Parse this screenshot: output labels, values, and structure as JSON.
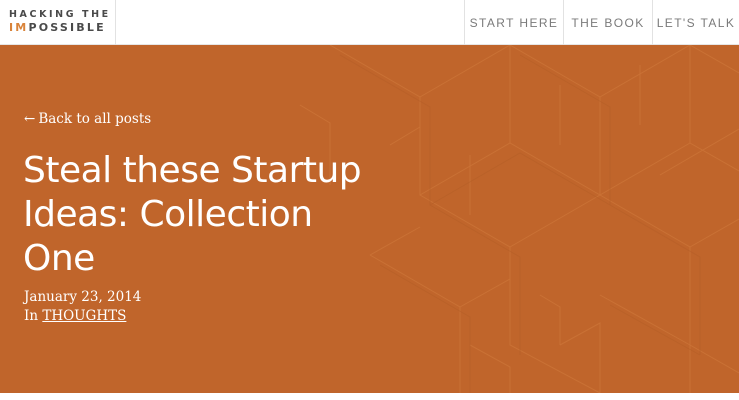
{
  "header": {
    "logo": {
      "line1": "HACKING THE",
      "line2_accent": "IM",
      "line2_rest": "POSSIBLE"
    },
    "nav": [
      {
        "label": "START HERE"
      },
      {
        "label": "THE BOOK"
      },
      {
        "label": "LET'S TALK"
      }
    ]
  },
  "hero": {
    "back_arrow": "←",
    "back_label": "Back to all posts",
    "title": "Steal these Startup Ideas: Collection One",
    "date": "January 23, 2014",
    "category_prefix": "In",
    "category": "THOUGHTS"
  },
  "colors": {
    "hero_background": "#c0652b",
    "accent": "#d9833a",
    "nav_text": "#7a7a7a",
    "logo_text": "#4a4a4a"
  },
  "icons": {
    "back": "left-arrow-icon"
  }
}
